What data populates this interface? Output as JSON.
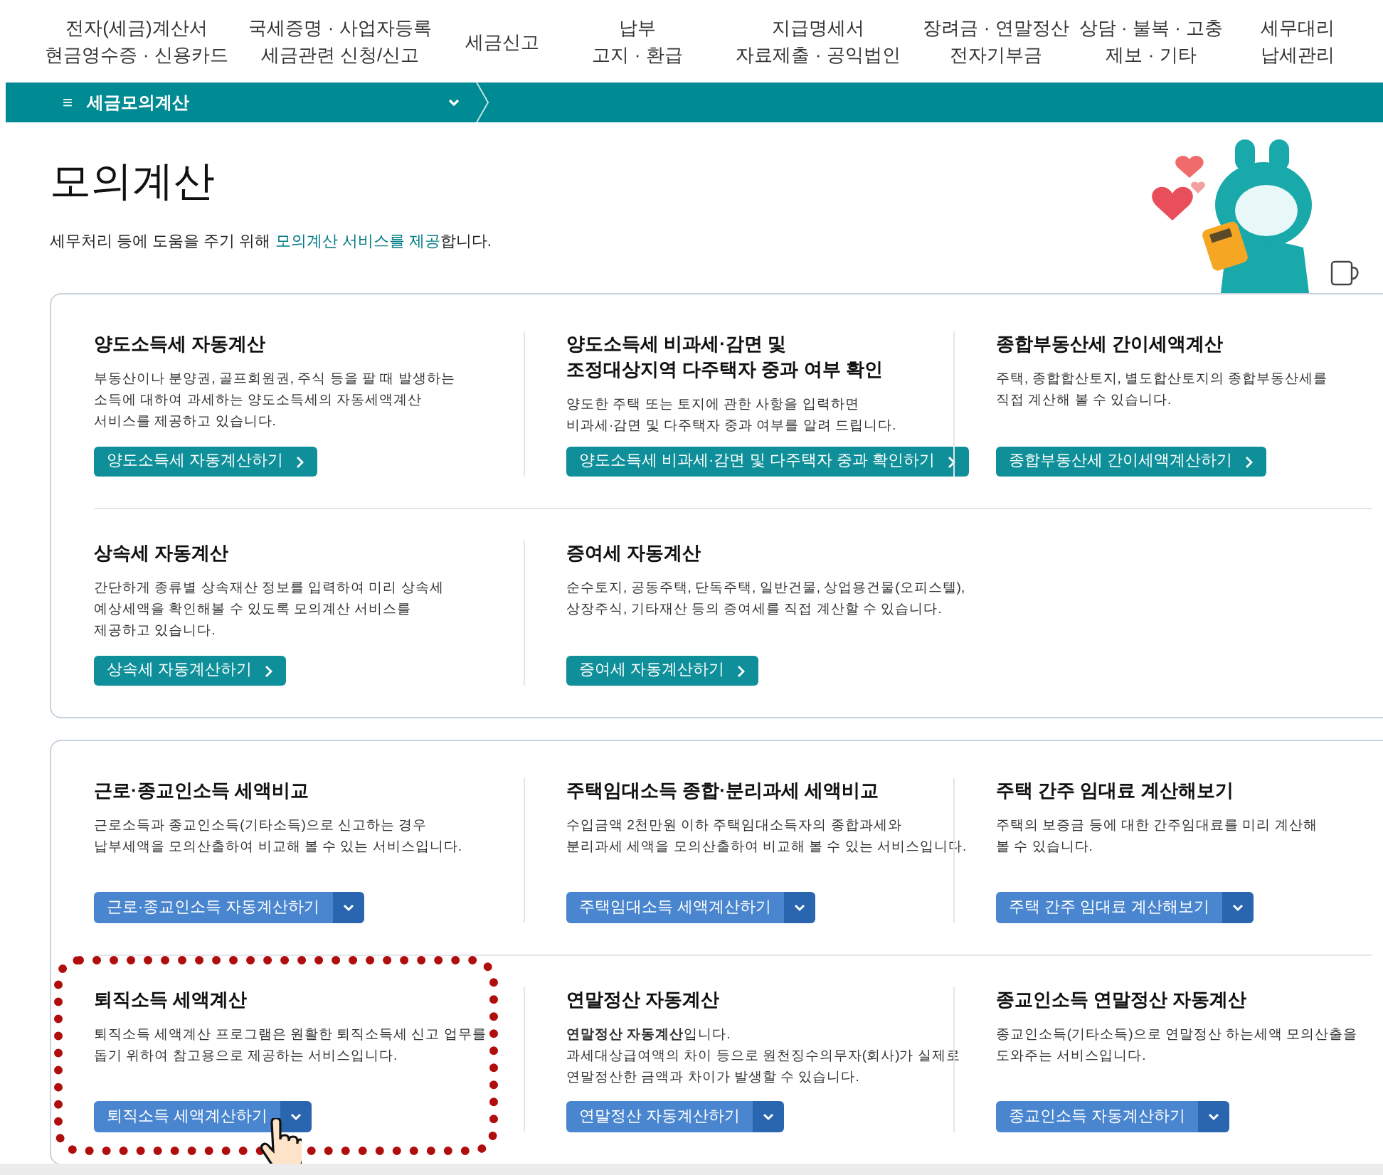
{
  "top_nav": [
    {
      "lines": [
        "전자(세금)계산서",
        "현금영수증 · 신용카드"
      ]
    },
    {
      "lines": [
        "국세증명 · 사업자등록",
        "세금관련 신청/신고"
      ]
    },
    {
      "lines": [
        "세금신고"
      ]
    },
    {
      "lines": [
        "납부",
        "고지 · 환급"
      ]
    },
    {
      "lines": [
        "지급명세서",
        "자료제출 · 공익법인"
      ]
    },
    {
      "lines": [
        "장려금 · 연말정산",
        "전자기부금"
      ]
    },
    {
      "lines": [
        "상담 · 불복 · 고충",
        "제보 · 기타"
      ]
    },
    {
      "lines": [
        "세무대리",
        "납세관리"
      ]
    }
  ],
  "breadcrumb": {
    "menu_icon": "≡",
    "label": "세금모의계산"
  },
  "page_title": "모의계산",
  "subtitle": {
    "before": "세무처리 등에 도움을 주기 위해 ",
    "link": "모의계산 서비스를 제공",
    "after": "합니다."
  },
  "panels": [
    {
      "cards": [
        {
          "title_lines": [
            "양도소득세 자동계산"
          ],
          "description_lines": [
            "부동산이나 분양권, 골프회원권, 주식 등을 팔 때 발생하는",
            "소득에 대하여 과세하는 양도소득세의 자동세액계산",
            "서비스를 제공하고 있습니다."
          ],
          "button": {
            "kind": "link",
            "label": "양도소득세 자동계산하기"
          },
          "highlighted": false
        },
        {
          "title_lines": [
            "양도소득세 비과세·감면 및",
            "조정대상지역 다주택자 중과 여부 확인"
          ],
          "description_lines": [
            "양도한 주택 또는 토지에 관한 사항을 입력하면",
            "비과세·감면 및 다주택자 중과 여부를 알려 드립니다."
          ],
          "button": {
            "kind": "link",
            "label": "양도소득세 비과세·감면 및 다주택자 중과 확인하기"
          },
          "highlighted": false
        },
        {
          "title_lines": [
            "종합부동산세 간이세액계산"
          ],
          "description_lines": [
            "주택, 종합합산토지, 별도합산토지의 종합부동산세를",
            "직접 계산해 볼 수 있습니다."
          ],
          "button": {
            "kind": "link",
            "label": "종합부동산세 간이세액계산하기"
          },
          "highlighted": false
        },
        {
          "title_lines": [
            "상속세 자동계산"
          ],
          "description_lines": [
            "간단하게 종류별 상속재산 정보를 입력하여 미리 상속세",
            "예상세액을 확인해볼 수 있도록 모의계산 서비스를",
            "제공하고 있습니다."
          ],
          "button": {
            "kind": "link",
            "label": "상속세 자동계산하기"
          },
          "highlighted": false
        },
        {
          "title_lines": [
            "증여세 자동계산"
          ],
          "description_lines": [
            "순수토지, 공동주택, 단독주택, 일반건물, 상업용건물(오피스텔),",
            "상장주식, 기타재산 등의 증여세를 직접 계산할 수 있습니다."
          ],
          "button": {
            "kind": "link",
            "label": "증여세 자동계산하기"
          },
          "highlighted": false
        }
      ]
    },
    {
      "cards": [
        {
          "title_lines": [
            "근로·종교인소득 세액비교"
          ],
          "description_lines": [
            "근로소득과 종교인소득(기타소득)으로 신고하는 경우",
            "납부세액을 모의산출하여 비교해 볼 수 있는 서비스입니다."
          ],
          "button": {
            "kind": "split",
            "label": "근로·종교인소득 자동계산하기"
          },
          "highlighted": false
        },
        {
          "title_lines": [
            "주택임대소득 종합·분리과세 세액비교"
          ],
          "description_lines": [
            "수입금액 2천만원 이하 주택임대소득자의 종합과세와",
            "분리과세 세액을 모의산출하여 비교해 볼 수 있는 서비스입니다."
          ],
          "button": {
            "kind": "split",
            "label": "주택임대소득 세액계산하기"
          },
          "highlighted": false
        },
        {
          "title_lines": [
            "주택 간주 임대료 계산해보기"
          ],
          "description_lines": [
            "주택의 보증금 등에 대한 간주임대료를 미리 계산해",
            "볼 수 있습니다."
          ],
          "button": {
            "kind": "split",
            "label": "주택 간주 임대료 계산해보기"
          },
          "highlighted": false
        },
        {
          "title_lines": [
            "퇴직소득 세액계산"
          ],
          "description_lines": [
            "퇴직소득 세액계산 프로그램은 원활한 퇴직소득세 신고 업무를",
            "돕기 위하여 참고용으로 제공하는 서비스입니다."
          ],
          "button": {
            "kind": "split",
            "label": "퇴직소득 세액계산하기"
          },
          "highlighted": true
        },
        {
          "title_lines": [
            "연말정산 자동계산"
          ],
          "description_lines": [
            "**연말정산 자동계산**입니다.",
            "과세대상급여액의 차이 등으로 원천징수의무자(회사)가 실제로",
            "연말정산한 금액과 차이가 발생할 수 있습니다."
          ],
          "button": {
            "kind": "split",
            "label": "연말정산 자동계산하기"
          },
          "highlighted": false
        },
        {
          "title_lines": [
            "종교인소득 연말정산 자동계산"
          ],
          "description_lines": [
            "종교인소득(기타소득)으로 연말정산 하는세액 모의산출을",
            "도와주는 서비스입니다."
          ],
          "button": {
            "kind": "split",
            "label": "종교인소득 자동계산하기"
          },
          "highlighted": false
        }
      ]
    }
  ]
}
